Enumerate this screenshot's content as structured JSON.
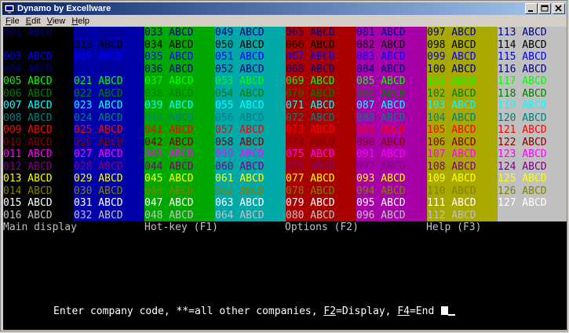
{
  "window": {
    "title": "Dynamo by Excellware",
    "controls": {
      "minimize": "_",
      "maximize": "□",
      "close": "×"
    }
  },
  "menu": [
    {
      "label": "File",
      "accel": "F"
    },
    {
      "label": "Edit",
      "accel": "E"
    },
    {
      "label": "View",
      "accel": "V"
    },
    {
      "label": "Help",
      "accel": "H"
    }
  ],
  "palette": {
    "foreground": [
      "#808080",
      "#000080",
      "#000000",
      "#0000ff",
      "#000080",
      "#00ff00",
      "#008000",
      "#00ffff",
      "#008080",
      "#ff0000",
      "#800000",
      "#ff00ff",
      "#800080",
      "#ffff00",
      "#808000",
      "#ffffff",
      "#c0c0c0"
    ],
    "backgrounds": [
      "#000000",
      "#0000a8",
      "#00a800",
      "#00a8a8",
      "#a80000",
      "#a800a8",
      "#a8a800",
      "#c0c0c0"
    ]
  },
  "grid_columns": [
    {
      "bg": "#000000",
      "codes": [
        "001",
        "",
        "003",
        "004",
        "005",
        "006",
        "007",
        "008",
        "009",
        "010",
        "011",
        "012",
        "013",
        "014",
        "015",
        "016"
      ]
    },
    {
      "bg": "#0000a8",
      "codes": [
        "017",
        "018",
        "019",
        "020",
        "021",
        "022",
        "023",
        "024",
        "025",
        "026",
        "027",
        "028",
        "029",
        "030",
        "031",
        "032"
      ]
    },
    {
      "bg": "#00a800",
      "codes": [
        "033",
        "034",
        "035",
        "036",
        "037",
        "038",
        "039",
        "040",
        "041",
        "042",
        "043",
        "044",
        "045",
        "046",
        "047",
        "048"
      ]
    },
    {
      "bg": "#00a8a8",
      "codes": [
        "049",
        "050",
        "051",
        "052",
        "053",
        "054",
        "055",
        "056",
        "057",
        "058",
        "059",
        "060",
        "061",
        "062",
        "063",
        "064"
      ]
    },
    {
      "bg": "#a80000",
      "codes": [
        "065",
        "066",
        "067",
        "068",
        "069",
        "070",
        "071",
        "072",
        "073",
        "074",
        "075",
        "076",
        "077",
        "078",
        "079",
        "080"
      ]
    },
    {
      "bg": "#a800a8",
      "codes": [
        "081",
        "082",
        "083",
        "084",
        "085",
        "086",
        "087",
        "088",
        "089",
        "090",
        "091",
        "092",
        "093",
        "094",
        "095",
        "096"
      ]
    },
    {
      "bg": "#a8a800",
      "codes": [
        "097",
        "098",
        "099",
        "100",
        "101",
        "102",
        "103",
        "104",
        "105",
        "106",
        "107",
        "108",
        "109",
        "110",
        "111",
        "112"
      ]
    },
    {
      "bg": "#c0c0c0",
      "codes": [
        "113",
        "114",
        "115",
        "116",
        "117",
        "118",
        "119",
        "120",
        "121",
        "122",
        "123",
        "124",
        "125",
        "126",
        "127",
        ""
      ]
    }
  ],
  "cell_suffix": "ABCD",
  "status_line": [
    {
      "label": "Main display"
    },
    {
      "label": "Hot-key (F1)"
    },
    {
      "label": "Options (F2)"
    },
    {
      "label": "Help (F3)"
    }
  ],
  "prompt": {
    "prefix": "Enter company code, **=all other companies, ",
    "f2_key": "F2",
    "f2_text": "=Display, ",
    "f4_key": "F4",
    "f4_text": "=End "
  }
}
